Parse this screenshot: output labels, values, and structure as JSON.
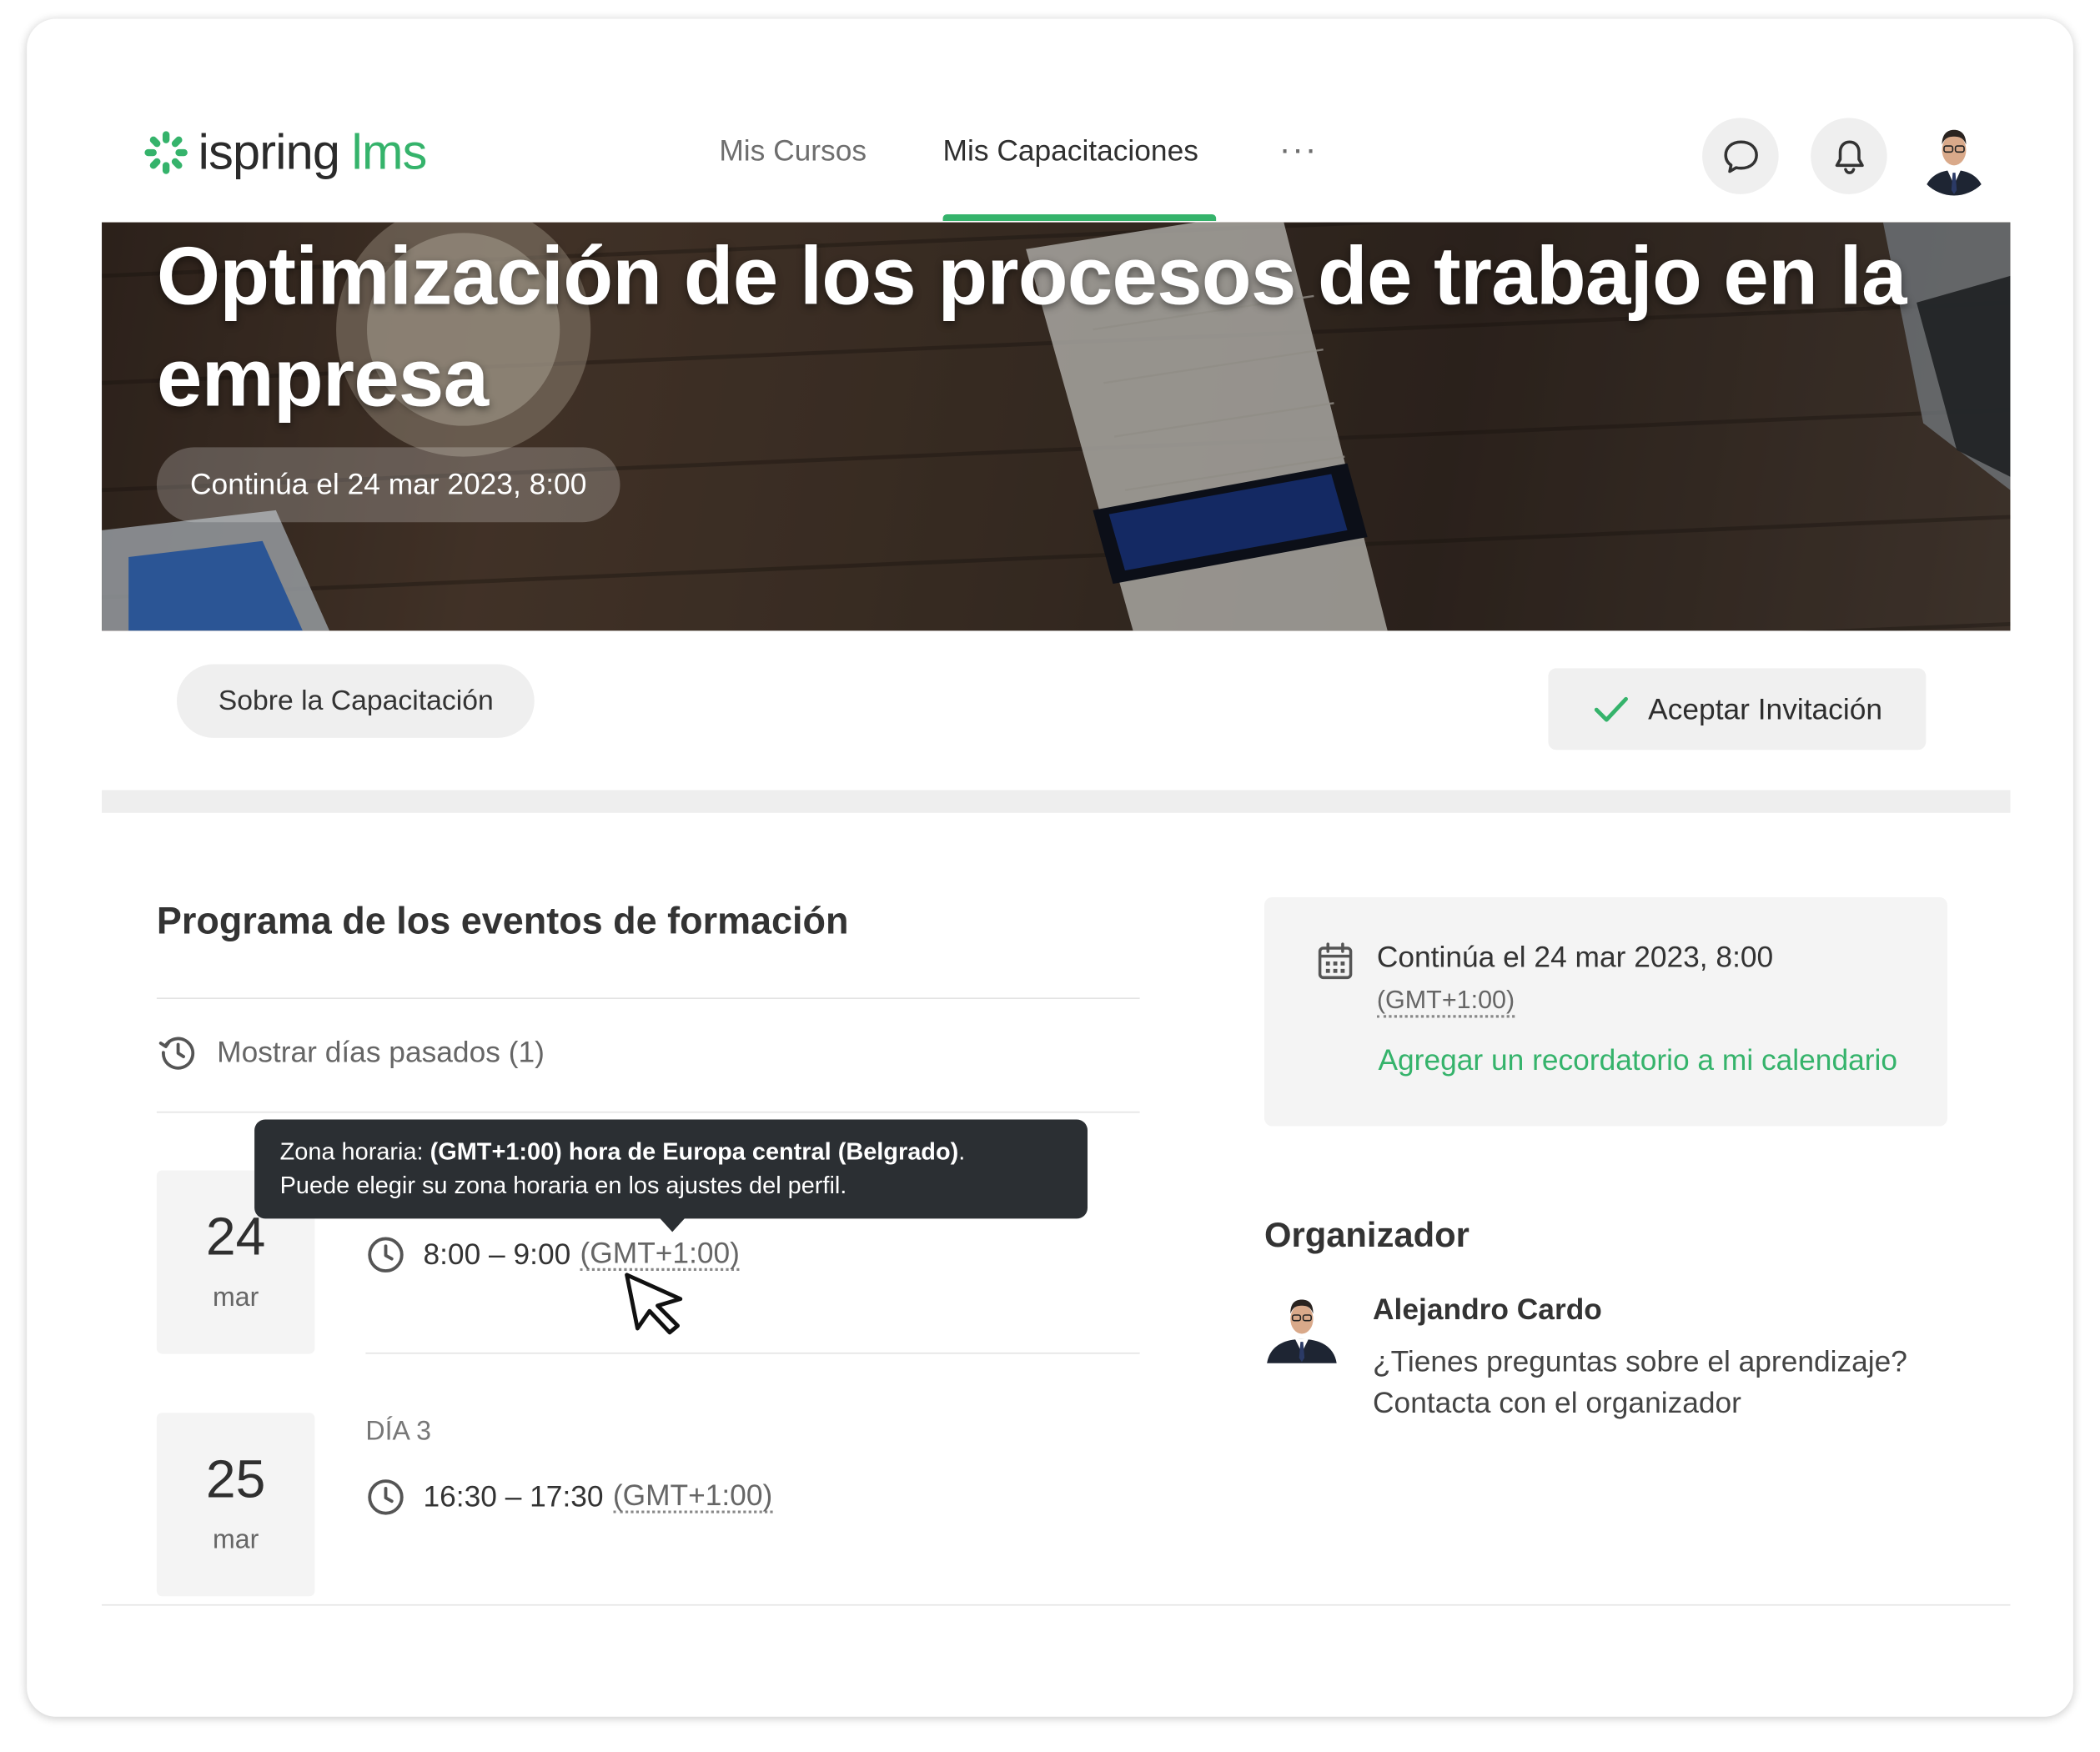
{
  "app": {
    "logo_name": "ispring",
    "logo_suffix": "lms"
  },
  "nav": {
    "items": [
      "Mis Cursos",
      "Mis Capacitaciones"
    ],
    "active_index": 1,
    "more_label": "···"
  },
  "header_icons": [
    "chat-icon",
    "bell-icon",
    "user-avatar"
  ],
  "hero": {
    "title": "Optimización de los procesos de trabajo en la empresa",
    "continues_label": "Continúa el 24 mar 2023, 8:00"
  },
  "actions": {
    "about_label": "Sobre la Capacitación",
    "accept_label": "Aceptar Invitación"
  },
  "schedule": {
    "title": "Programa de los eventos de formación",
    "show_past_label": "Mostrar días pasados (1)",
    "events": [
      {
        "day_number": "24",
        "month": "mar",
        "day_label": "",
        "time": "8:00 – 9:00",
        "timezone": "(GMT+1:00)"
      },
      {
        "day_number": "25",
        "month": "mar",
        "day_label": "DÍA 3",
        "time": "16:30 – 17:30",
        "timezone": "(GMT+1:00)"
      }
    ]
  },
  "tooltip": {
    "prefix": "Zona horaria: ",
    "bold": "(GMT+1:00) hora de Europa central (Belgrado)",
    "suffix": ".",
    "line2": "Puede elegir su zona horaria en los ajustes del perfil."
  },
  "info": {
    "continues": "Continúa el 24 mar 2023, 8:00",
    "timezone": "(GMT+1:00)",
    "reminder_link": "Agregar un recordatorio a mi calendario"
  },
  "organizer": {
    "section_title": "Organizador",
    "name": "Alejandro Cardo",
    "question": "¿Tienes preguntas sobre el aprendizaje?",
    "contact": "Contacta con el organizador"
  },
  "colors": {
    "accent": "#35b36b",
    "tooltip_bg": "#2b2f33",
    "text": "#333333"
  }
}
